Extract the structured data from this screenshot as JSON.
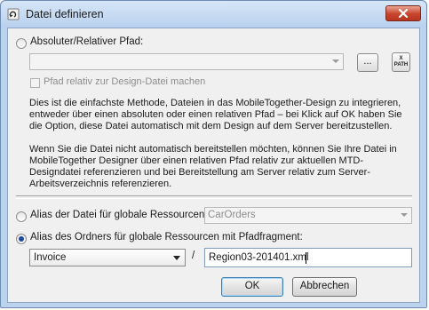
{
  "window": {
    "title": "Datei definieren",
    "icons": {
      "title": "define-file-icon",
      "close": "close-icon"
    },
    "colors": {
      "frame": "#bcd3ee",
      "client": "#f0f0f0",
      "close": "#c7432b",
      "selected_radio": "#1f4a9c"
    }
  },
  "absolute": {
    "label": "Absoluter/Relativer Pfad:",
    "path_value": "",
    "browse_label": "...",
    "xpath_label_top": "X",
    "xpath_label_bottom": "PATH",
    "relative_checkbox_label": "Pfad relativ zur Design-Datei machen",
    "description1": "Dies ist die einfachste Methode, Dateien in das MobileTogether-Design zu integrieren, entweder über einen absoluten oder einen relativen Pfad – bei Klick auf OK haben Sie die Option, diese Datei automatisch mit dem Design auf dem Server bereitzustellen.",
    "description2": "Wenn Sie die Datei nicht automatisch bereitstellen möchten, können Sie Ihre Datei in MobileTogether Designer über einen relativen Pfad relativ zur aktuellen MTD-Designdatei referenzieren und bei Bereitstellung am Server relativ zum Server-Arbeitsverzeichnis referenzieren."
  },
  "alias_file": {
    "label": "Alias der Datei für globale Ressourcen:",
    "value": "CarOrders"
  },
  "alias_folder": {
    "label": "Alias des Ordners für globale Ressourcen mit Pfadfragment:",
    "folder_value": "Invoice",
    "separator": "/",
    "fragment_value": "Region03-201401.xml"
  },
  "buttons": {
    "ok": "OK",
    "cancel": "Abbrechen"
  }
}
